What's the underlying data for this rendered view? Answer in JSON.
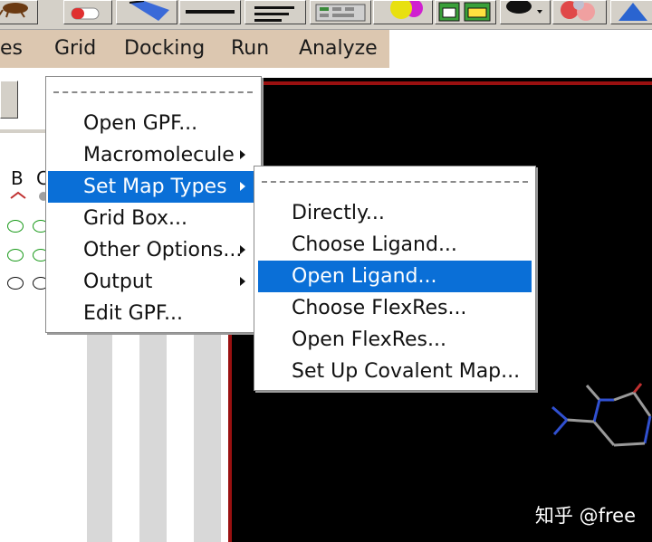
{
  "toolbar": {
    "buttons": [
      "bug-icon",
      "capsule-icon",
      "magnet-icon",
      "line-icon",
      "text-lines-icon",
      "table-icon",
      "spheres-icon",
      "grid-icon",
      "ball-icon",
      "molecule-icon",
      "up-arrow-icon"
    ]
  },
  "menubar": {
    "items": [
      "es",
      "Grid",
      "Docking",
      "Run",
      "Analyze"
    ]
  },
  "left_panel": {
    "col_b": "B",
    "col_c": "C"
  },
  "grid_menu": {
    "items": [
      {
        "label": "Open GPF...",
        "submenu": false
      },
      {
        "label": "Macromolecule",
        "submenu": true
      },
      {
        "label": "Set Map Types",
        "submenu": true,
        "selected": true
      },
      {
        "label": "Grid Box...",
        "submenu": false
      },
      {
        "label": "Other Options...",
        "submenu": true
      },
      {
        "label": "Output",
        "submenu": true
      },
      {
        "label": "Edit GPF...",
        "submenu": false
      }
    ]
  },
  "map_types_menu": {
    "items": [
      {
        "label": "Directly...",
        "selected": false
      },
      {
        "label": "Choose Ligand...",
        "selected": false
      },
      {
        "label": "Open Ligand...",
        "selected": true
      },
      {
        "label": "Choose FlexRes...",
        "selected": false
      },
      {
        "label": "Open FlexRes...",
        "selected": false
      },
      {
        "label": "Set Up Covalent Map...",
        "selected": false
      }
    ]
  },
  "colors": {
    "menubar_bg": "#dcc7b0",
    "selection": "#0a6fd7",
    "viewer_bg": "#000000",
    "ellipse_green": "#1a9a1a"
  },
  "watermark": "知乎 @free"
}
